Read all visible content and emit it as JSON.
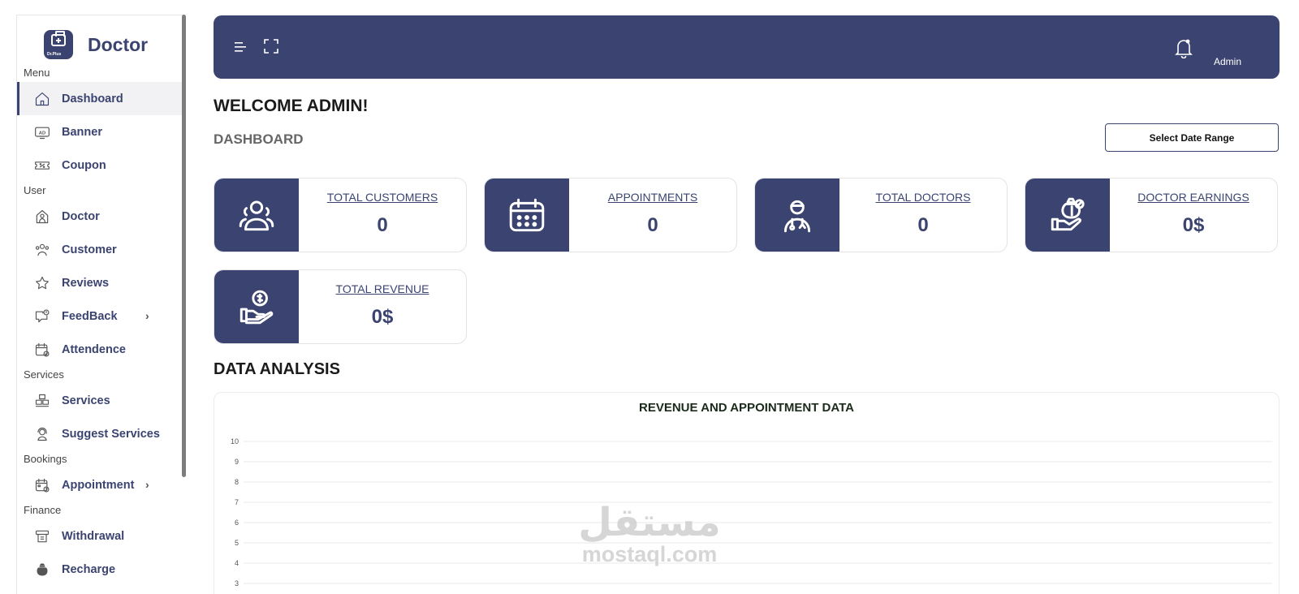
{
  "brand": {
    "name": "Doctor",
    "logo_text": "Dr.Plus"
  },
  "sidebar": {
    "sections": [
      {
        "label": "Menu",
        "items": [
          {
            "label": "Dashboard",
            "icon": "home-icon",
            "active": true
          },
          {
            "label": "Banner",
            "icon": "ad-icon"
          },
          {
            "label": "Coupon",
            "icon": "coupon-icon"
          }
        ]
      },
      {
        "label": "User",
        "items": [
          {
            "label": "Doctor",
            "icon": "doctor-icon"
          },
          {
            "label": "Customer",
            "icon": "users-icon"
          },
          {
            "label": "Reviews",
            "icon": "star-icon"
          },
          {
            "label": "FeedBack",
            "icon": "feedback-icon",
            "submenu": true
          },
          {
            "label": "Attendence",
            "icon": "calendar-check-icon"
          }
        ]
      },
      {
        "label": "Services",
        "items": [
          {
            "label": "Services",
            "icon": "boxes-icon"
          },
          {
            "label": "Suggest Services",
            "icon": "support-agent-icon"
          }
        ]
      },
      {
        "label": "Bookings",
        "items": [
          {
            "label": "Appointment",
            "icon": "calendar-clock-icon",
            "submenu": true
          }
        ]
      },
      {
        "label": "Finance",
        "items": [
          {
            "label": "Withdrawal",
            "icon": "withdraw-icon"
          },
          {
            "label": "Recharge",
            "icon": "money-bag-icon"
          }
        ]
      }
    ]
  },
  "header": {
    "user_label": "Admin"
  },
  "page": {
    "welcome": "WELCOME ADMIN!",
    "title": "DASHBOARD",
    "date_button": "Select Date Range",
    "analysis_title": "DATA ANALYSIS"
  },
  "stats": [
    {
      "label": "TOTAL CUSTOMERS",
      "value": "0",
      "icon": "customers-icon"
    },
    {
      "label": "APPOINTMENTS",
      "value": "0",
      "icon": "calendar-icon"
    },
    {
      "label": "TOTAL DOCTORS",
      "value": "0",
      "icon": "doctor-icon"
    },
    {
      "label": "DOCTOR EARNINGS",
      "value": "0$",
      "icon": "earnings-icon"
    },
    {
      "label": "TOTAL REVENUE",
      "value": "0$",
      "icon": "revenue-icon"
    }
  ],
  "chart_data": {
    "type": "line",
    "title": "REVENUE AND APPOINTMENT DATA",
    "ylim": [
      0,
      10
    ],
    "y_ticks": [
      3,
      4,
      5,
      6,
      7,
      8,
      9,
      10
    ],
    "grid": true,
    "series": []
  },
  "watermark": {
    "arabic": "مستقل",
    "latin": "mostaql.com"
  },
  "colors": {
    "primary": "#3b4470",
    "background": "#ffffff"
  }
}
